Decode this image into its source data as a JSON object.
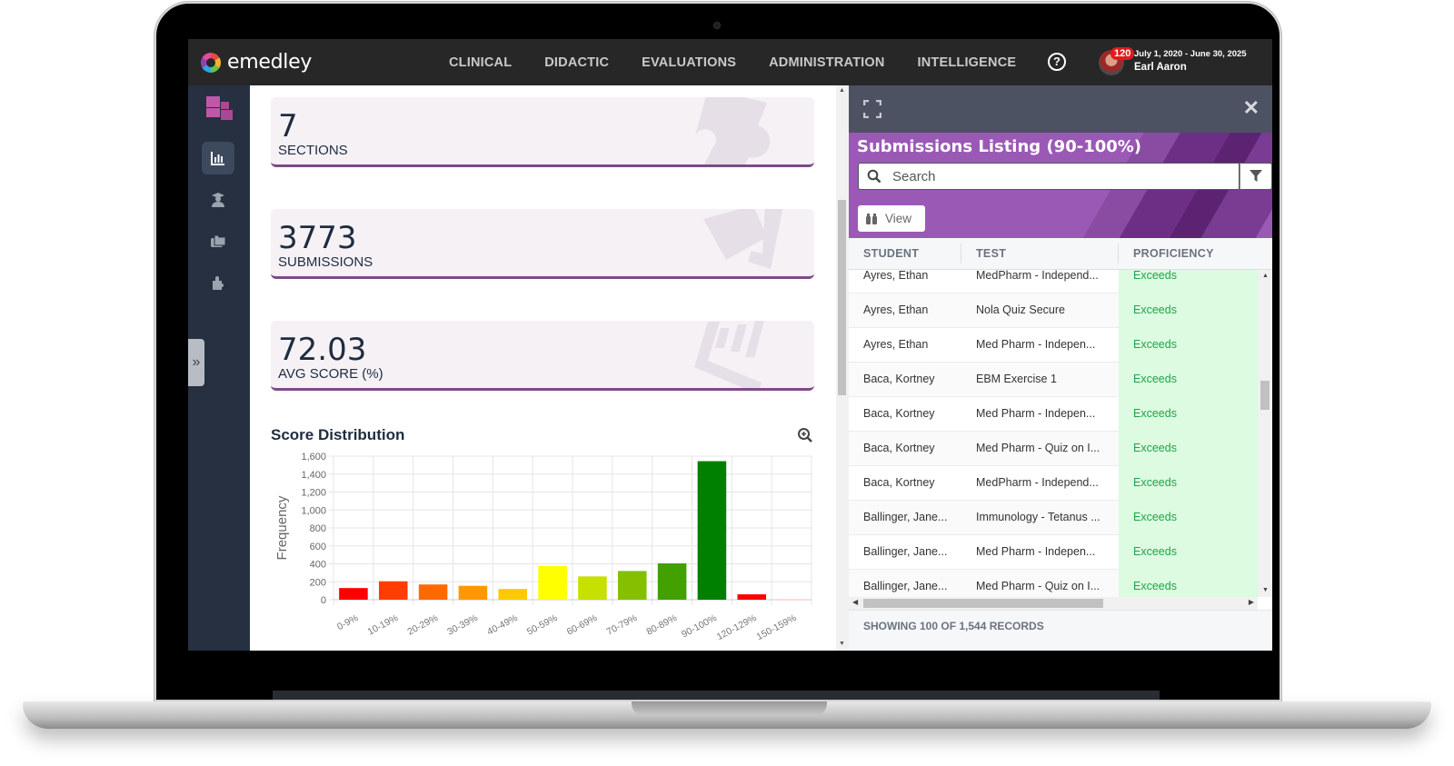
{
  "app": {
    "brand": "emedley",
    "nav": [
      "CLINICAL",
      "DIDACTIC",
      "EVALUATIONS",
      "ADMINISTRATION",
      "INTELLIGENCE"
    ],
    "help_icon": "question-circle-icon",
    "notification_count": "120",
    "date_range": "July 1, 2020 - June 30, 2025",
    "user_name": "Earl Aaron"
  },
  "sidebar": {
    "items": [
      {
        "name": "analytics",
        "icon": "bar-chart-icon",
        "active": true
      },
      {
        "name": "students",
        "icon": "graduate-icon",
        "active": false
      },
      {
        "name": "folders",
        "icon": "folders-icon",
        "active": false
      },
      {
        "name": "sections",
        "icon": "puzzle-icon",
        "active": false
      }
    ],
    "expand_label": "»"
  },
  "stats": [
    {
      "value": "7",
      "label": "SECTIONS",
      "icon": "puzzle-icon"
    },
    {
      "value": "3773",
      "label": "SUBMISSIONS",
      "icon": "submit-icon"
    },
    {
      "value": "72.03",
      "label": "AVG SCORE (%)",
      "icon": "chart-icon"
    }
  ],
  "chart_section": {
    "title": "Score Distribution"
  },
  "chart_data": {
    "type": "bar",
    "title": "Score Distribution",
    "xlabel": "",
    "ylabel": "Frequency",
    "ylim": [
      0,
      1600
    ],
    "yticks": [
      "0",
      "200",
      "400",
      "600",
      "800",
      "1,000",
      "1,200",
      "1,400",
      "1,600"
    ],
    "ytick_values": [
      0,
      200,
      400,
      600,
      800,
      1000,
      1200,
      1400,
      1600
    ],
    "grid": true,
    "categories": [
      "0-9%",
      "10-19%",
      "20-29%",
      "30-39%",
      "40-49%",
      "50-59%",
      "60-69%",
      "70-79%",
      "80-89%",
      "90-100%",
      "120-129%",
      "150-159%"
    ],
    "values": [
      130,
      205,
      170,
      155,
      120,
      375,
      260,
      320,
      405,
      1544,
      60,
      5
    ],
    "colors": [
      "#ff0000",
      "#ff3d00",
      "#ff6a00",
      "#ff9800",
      "#ffc800",
      "#ffff00",
      "#c6e000",
      "#84c000",
      "#42a000",
      "#008000",
      "#ff0000",
      "#ffb0b0"
    ]
  },
  "panel": {
    "title": "Submissions Listing (90-100%)",
    "search_placeholder": "Search",
    "view_label": "View",
    "columns": [
      "STUDENT",
      "TEST",
      "PROFICIENCY"
    ],
    "rows": [
      {
        "student": "Ayres, Ethan",
        "test": "MedPharm - Independ...",
        "proficiency": "Exceeds"
      },
      {
        "student": "Ayres, Ethan",
        "test": "Nola Quiz Secure",
        "proficiency": "Exceeds"
      },
      {
        "student": "Ayres, Ethan",
        "test": "Med Pharm - Indepen...",
        "proficiency": "Exceeds"
      },
      {
        "student": "Baca, Kortney",
        "test": "EBM Exercise 1",
        "proficiency": "Exceeds"
      },
      {
        "student": "Baca, Kortney",
        "test": "Med Pharm - Indepen...",
        "proficiency": "Exceeds"
      },
      {
        "student": "Baca, Kortney",
        "test": "Med Pharm - Quiz on I...",
        "proficiency": "Exceeds"
      },
      {
        "student": "Baca, Kortney",
        "test": "MedPharm - Independ...",
        "proficiency": "Exceeds"
      },
      {
        "student": "Ballinger, Jane...",
        "test": "Immunology - Tetanus ...",
        "proficiency": "Exceeds"
      },
      {
        "student": "Ballinger, Jane...",
        "test": "Med Pharm - Indepen...",
        "proficiency": "Exceeds"
      },
      {
        "student": "Ballinger, Jane...",
        "test": "Med Pharm - Quiz on I...",
        "proficiency": "Exceeds"
      }
    ],
    "footer": "SHOWING 100 OF 1,544 RECORDS"
  }
}
